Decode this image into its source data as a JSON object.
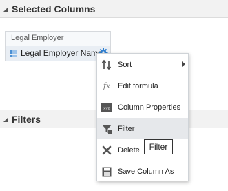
{
  "selected_columns": {
    "title": "Selected Columns",
    "folder_label": "Legal Employer",
    "column_name": "Legal Employer Name"
  },
  "filters": {
    "title": "Filters"
  },
  "context_menu": {
    "items": [
      {
        "label": "Sort",
        "icon": "sort-icon",
        "has_submenu": true
      },
      {
        "label": "Edit formula",
        "icon": "fx-icon"
      },
      {
        "label": "Column Properties",
        "icon": "column-properties-icon"
      },
      {
        "label": "Filter",
        "icon": "filter-icon",
        "highlighted": true
      },
      {
        "label": "Delete",
        "icon": "delete-icon"
      },
      {
        "label": "Save Column As",
        "icon": "save-icon"
      }
    ]
  },
  "tooltip": {
    "text": "Filter"
  },
  "colors": {
    "header_bg": "#f2f2f2",
    "card_bg": "#f7f9fb",
    "row_bg": "#e9eef4",
    "accent_blue": "#4a8fd3",
    "menu_highlight": "#e6e8eb"
  }
}
